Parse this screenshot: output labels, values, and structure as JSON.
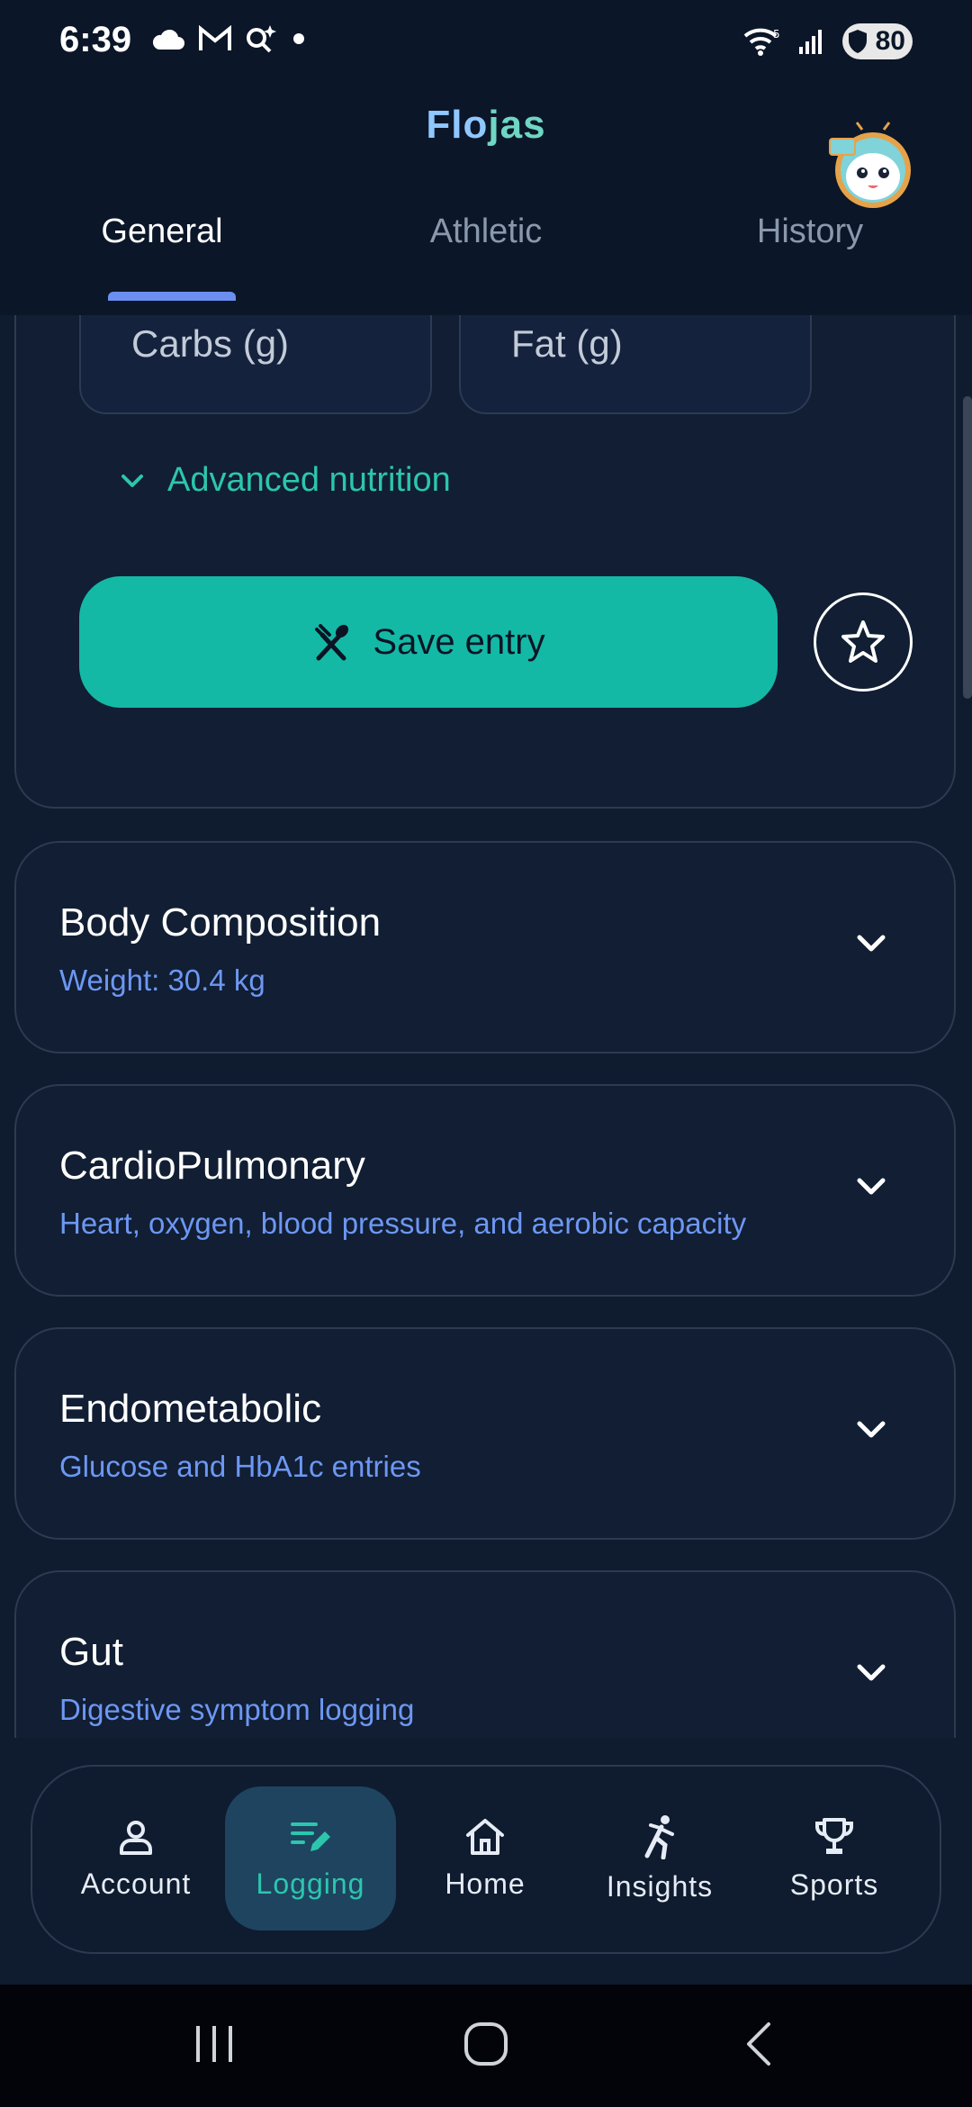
{
  "status_bar": {
    "time": "6:39",
    "battery": "80"
  },
  "header": {
    "title_part1": "Flo",
    "title_part2": "jas"
  },
  "tabs": [
    {
      "label": "General",
      "active": true
    },
    {
      "label": "Athletic",
      "active": false
    },
    {
      "label": "History",
      "active": false
    }
  ],
  "entry_form": {
    "carbs_placeholder": "Carbs (g)",
    "fat_placeholder": "Fat (g)",
    "advanced_label": "Advanced nutrition",
    "save_label": "Save entry"
  },
  "sections": [
    {
      "title": "Body Composition",
      "subtitle": "Weight: 30.4 kg"
    },
    {
      "title": "CardioPulmonary",
      "subtitle": "Heart, oxygen, blood pressure, and aerobic capacity"
    },
    {
      "title": "Endometabolic",
      "subtitle": "Glucose and HbA1c entries"
    },
    {
      "title": "Gut",
      "subtitle": "Digestive symptom logging"
    }
  ],
  "bottom_nav": [
    {
      "label": "Account",
      "icon": "person-icon"
    },
    {
      "label": "Logging",
      "icon": "edit-list-icon",
      "active": true
    },
    {
      "label": "Home",
      "icon": "home-icon"
    },
    {
      "label": "Insights",
      "icon": "runner-icon"
    },
    {
      "label": "Sports",
      "icon": "trophy-icon"
    }
  ],
  "colors": {
    "accent": "#14b9a6",
    "link": "#6d97f3",
    "background": "#0f1b2e"
  }
}
